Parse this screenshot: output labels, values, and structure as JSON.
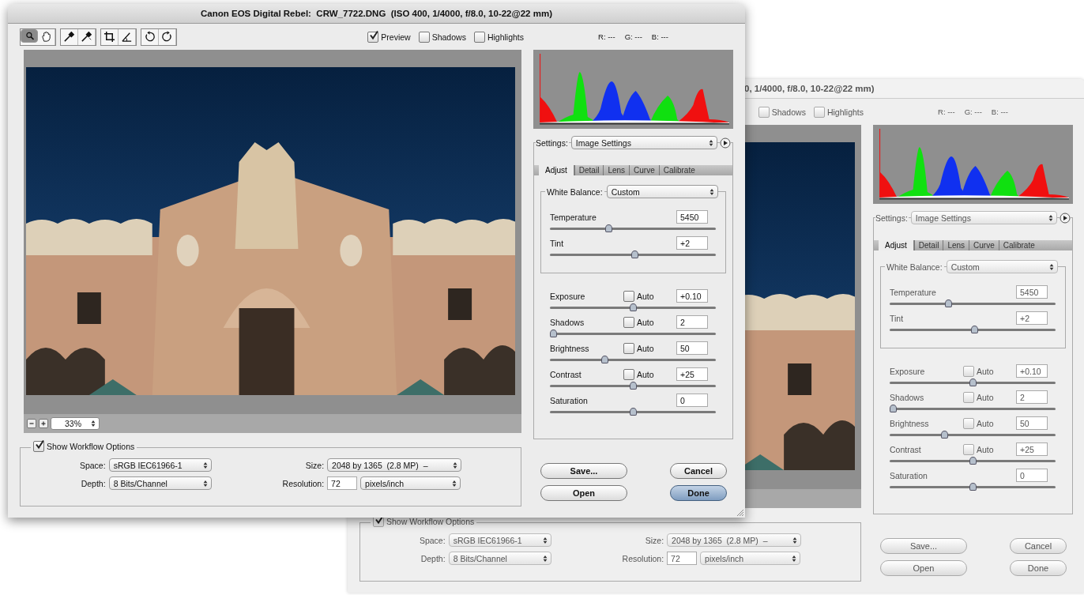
{
  "windows": [
    {
      "active": true,
      "title": "Canon EOS Digital Rebel:  CRW_7722.DNG  (ISO 400, 1/4000, f/8.0, 10-22@22 mm)",
      "tool_groups": [
        [
          {
            "kind": "zoom",
            "selected": true
          },
          {
            "kind": "hand",
            "selected": false
          }
        ],
        [
          {
            "kind": "eyedropper",
            "selected": false
          },
          {
            "kind": "sampler",
            "selected": false
          }
        ],
        [
          {
            "kind": "crop",
            "selected": false
          },
          {
            "kind": "straighten",
            "selected": false
          }
        ],
        [
          {
            "kind": "rotateleft",
            "selected": false
          },
          {
            "kind": "rotateright",
            "selected": false
          }
        ]
      ],
      "view_options": [
        {
          "label": "Preview",
          "checked": true
        },
        {
          "label": "Shadows",
          "checked": false
        },
        {
          "label": "Highlights",
          "checked": false
        }
      ],
      "readout": [
        "R: ---",
        "G: ---",
        "B: ---"
      ],
      "zoom": {
        "value": "33%"
      },
      "settings": {
        "label": "Settings:",
        "value": "Image Settings"
      },
      "tabs": [
        {
          "label": "Adjust",
          "selected": true
        },
        {
          "label": "Detail",
          "selected": false
        },
        {
          "label": "Lens",
          "selected": false
        },
        {
          "label": "Curve",
          "selected": false
        },
        {
          "label": "Calibrate",
          "selected": false
        }
      ],
      "white_balance": {
        "label": "White Balance:",
        "value": "Custom"
      },
      "wb_sliders": [
        {
          "label": "Temperature",
          "value": "5450",
          "level": 0.35
        },
        {
          "label": "Tint",
          "value": "+2",
          "level": 0.51
        }
      ],
      "sliders": [
        {
          "label": "Exposure",
          "auto": {
            "label": "Auto",
            "checked": false
          },
          "value": "+0.10",
          "level": 0.5
        },
        {
          "label": "Shadows",
          "auto": {
            "label": "Auto",
            "checked": false
          },
          "value": "2",
          "level": 0.02
        },
        {
          "label": "Brightness",
          "auto": {
            "label": "Auto",
            "checked": false
          },
          "value": "50",
          "level": 0.33
        },
        {
          "label": "Contrast",
          "auto": {
            "label": "Auto",
            "checked": false
          },
          "value": "+25",
          "level": 0.5
        },
        {
          "label": "Saturation",
          "value": "0",
          "level": 0.5
        }
      ],
      "workflow": {
        "label": "Show Workflow Options",
        "checked": true,
        "space": {
          "label": "Space:",
          "value": "sRGB IEC61966-1"
        },
        "size": {
          "label": "Size:",
          "value": "2048 by 1365  (2.8 MP)  –"
        },
        "depth": {
          "label": "Depth:",
          "value": "8 Bits/Channel"
        },
        "resolution": {
          "label": "Resolution:",
          "value": "72"
        },
        "units": {
          "value": "pixels/inch"
        }
      },
      "buttons": [
        {
          "label": "Save...",
          "default": false
        },
        {
          "label": "Cancel",
          "default": false
        },
        {
          "label": "Open",
          "default": false
        },
        {
          "label": "Done",
          "default": true
        }
      ]
    },
    {
      "active": false,
      "title": "0, 1/4000, f/8.0, 10-22@22 mm)",
      "view_options": [
        {
          "label": "Shadows",
          "checked": false
        },
        {
          "label": "Highlights",
          "checked": false
        }
      ],
      "readout": [
        "R: ---",
        "G: ---",
        "B: ---"
      ],
      "settings": {
        "label": "Settings:",
        "value": "Image Settings"
      },
      "tabs": [
        {
          "label": "Adjust",
          "selected": true
        },
        {
          "label": "Detail",
          "selected": false
        },
        {
          "label": "Lens",
          "selected": false
        },
        {
          "label": "Curve",
          "selected": false
        },
        {
          "label": "Calibrate",
          "selected": false
        }
      ],
      "white_balance": {
        "label": "White Balance:",
        "value": "Custom"
      },
      "wb_sliders": [
        {
          "label": "Temperature",
          "value": "5450",
          "level": 0.35
        },
        {
          "label": "Tint",
          "value": "+2",
          "level": 0.51
        }
      ],
      "sliders": [
        {
          "label": "Exposure",
          "auto": {
            "label": "Auto",
            "checked": false
          },
          "value": "+0.10",
          "level": 0.5
        },
        {
          "label": "Shadows",
          "auto": {
            "label": "Auto",
            "checked": false
          },
          "value": "2",
          "level": 0.02
        },
        {
          "label": "Brightness",
          "auto": {
            "label": "Auto",
            "checked": false
          },
          "value": "50",
          "level": 0.33
        },
        {
          "label": "Contrast",
          "auto": {
            "label": "Auto",
            "checked": false
          },
          "value": "+25",
          "level": 0.5
        },
        {
          "label": "Saturation",
          "value": "0",
          "level": 0.5
        }
      ],
      "workflow": {
        "label": "Show Workflow Options",
        "checked": true,
        "space": {
          "label": "Space:",
          "value": "sRGB IEC61966-1"
        },
        "size": {
          "label": "Size:",
          "value": "2048 by 1365  (2.8 MP)  –"
        },
        "depth": {
          "label": "Depth:",
          "value": "8 Bits/Channel"
        },
        "resolution": {
          "label": "Resolution:",
          "value": "72"
        },
        "units": {
          "value": "pixels/inch"
        }
      },
      "buttons": [
        {
          "label": "Save...",
          "default": false
        },
        {
          "label": "Cancel",
          "default": false
        },
        {
          "label": "Open",
          "default": false
        },
        {
          "label": "Done",
          "default": false
        }
      ]
    }
  ]
}
